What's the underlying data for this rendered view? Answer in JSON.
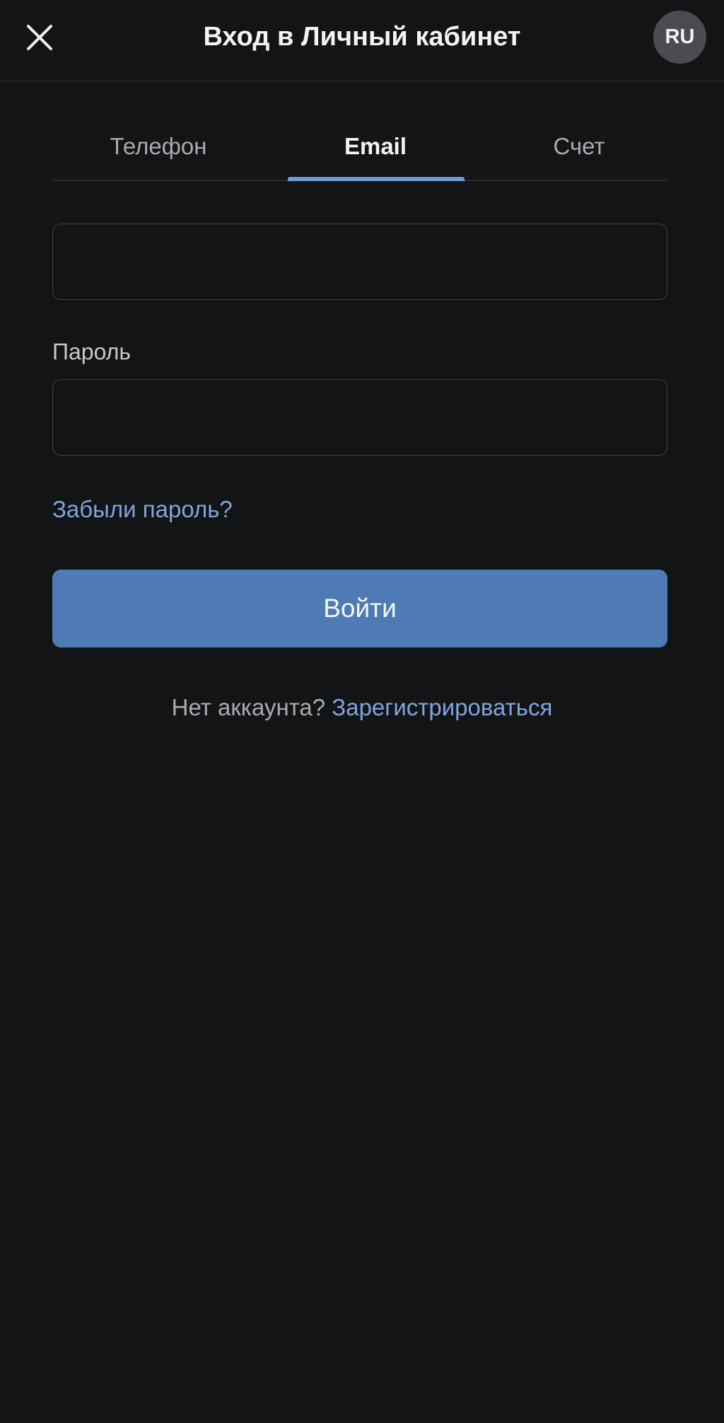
{
  "header": {
    "title": "Вход в Личный кабинет",
    "language": "RU",
    "close_icon": "close-icon"
  },
  "tabs": [
    {
      "label": "Телефон",
      "active": false
    },
    {
      "label": "Email",
      "active": true
    },
    {
      "label": "Счет",
      "active": false
    }
  ],
  "form": {
    "email_value": "",
    "password_label": "Пароль",
    "password_value": "",
    "forgot_password": "Забыли пароль?",
    "submit_label": "Войти"
  },
  "signup": {
    "prompt": "Нет аккаунта?",
    "link": "Зарегистрироваться"
  },
  "colors": {
    "background": "#131416",
    "accent": "#6b9bd8",
    "link": "#7ea6dc",
    "button": "#4e7bb4"
  }
}
